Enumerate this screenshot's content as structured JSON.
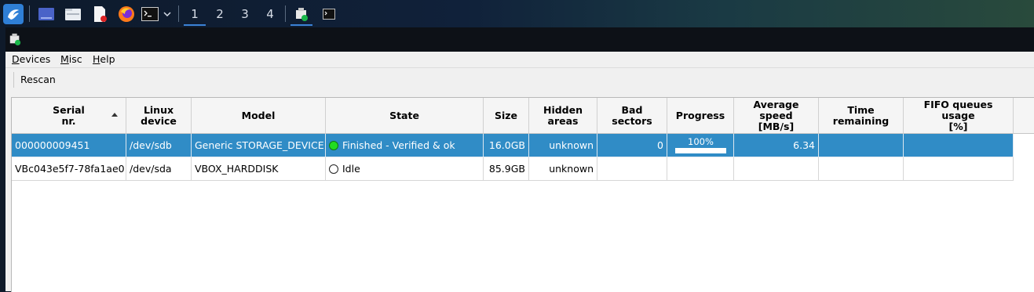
{
  "taskbar": {
    "workspaces": [
      "1",
      "2",
      "3",
      "4"
    ],
    "active_workspace": "1",
    "launchers": [
      "dragon-start-icon",
      "desktop-icon",
      "file-manager-icon",
      "text-editor-icon",
      "firefox-icon",
      "terminal-icon"
    ]
  },
  "menu": {
    "devices": "Devices",
    "misc": "Misc",
    "help": "Help"
  },
  "toolbar": {
    "rescan": "Rescan"
  },
  "table": {
    "columns": [
      "Serial\nnr.",
      "Linux\ndevice",
      "Model",
      "State",
      "Size",
      "Hidden\nareas",
      "Bad\nsectors",
      "Progress",
      "Average\nspeed\n[MB/s]",
      "Time\nremaining",
      "FIFO queues\nusage\n[%]"
    ],
    "sort_column": "Serial\nnr.",
    "rows": [
      {
        "serial": "000000009451",
        "device": "/dev/sdb",
        "model": "Generic STORAGE_DEVICE",
        "state": "Finished - Verified & ok",
        "state_color": "#22dd22",
        "size": "16.0GB",
        "hidden": "unknown",
        "bad": "0",
        "progress_text": "100%",
        "progress": 1.0,
        "speed": "6.34",
        "time": "",
        "fifo": "",
        "selected": true
      },
      {
        "serial": "VBc043e5f7-78fa1ae0",
        "device": "/dev/sda",
        "model": "VBOX_HARDDISK",
        "state": "Idle",
        "state_color": "#ffffff",
        "size": "85.9GB",
        "hidden": "unknown",
        "bad": "",
        "progress_text": "",
        "progress": null,
        "speed": "",
        "time": "",
        "fifo": "",
        "selected": false
      }
    ]
  },
  "colors": {
    "selection": "#308cc6",
    "accent": "#3b82d6"
  }
}
